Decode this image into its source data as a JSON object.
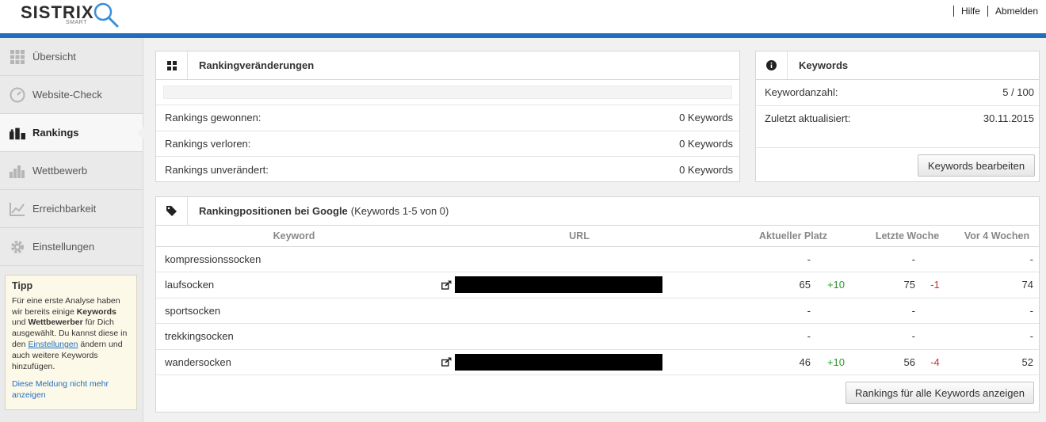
{
  "header": {
    "logo_text": "SISTRIX",
    "logo_sub": "SMART",
    "links": [
      "Hilfe",
      "Abmelden"
    ]
  },
  "colors": {
    "accent": "#1f6fbf",
    "positive": "#2a9a2a",
    "negative": "#d02f2f"
  },
  "sidebar": {
    "items": [
      {
        "label": "Übersicht",
        "icon": "grid-icon",
        "active": false
      },
      {
        "label": "Website-Check",
        "icon": "gauge-icon",
        "active": false
      },
      {
        "label": "Rankings",
        "icon": "rankings-icon",
        "active": true
      },
      {
        "label": "Wettbewerb",
        "icon": "bar-chart-icon",
        "active": false
      },
      {
        "label": "Erreichbarkeit",
        "icon": "line-chart-icon",
        "active": false
      },
      {
        "label": "Einstellungen",
        "icon": "gear-icon",
        "active": false
      }
    ],
    "tip": {
      "title": "Tipp",
      "text_1": "Für eine erste Analyse haben wir bereits einige ",
      "bold_1": "Keywords",
      "text_2": " und ",
      "bold_2": "Wettbewerber",
      "text_3": " für Dich ausgewählt. Du kannst diese in den ",
      "link": "Einstellungen",
      "text_4": " ändern und auch weitere Keywords hinzufügen.",
      "dismiss": "Diese Meldung nicht mehr anzeigen"
    }
  },
  "ranking_changes": {
    "title": "Rankingveränderungen",
    "rows": [
      {
        "label": "Rankings gewonnen:",
        "value": "0 Keywords"
      },
      {
        "label": "Rankings verloren:",
        "value": "0 Keywords"
      },
      {
        "label": "Rankings unverändert:",
        "value": "0 Keywords"
      }
    ]
  },
  "keywords_panel": {
    "title": "Keywords",
    "rows": [
      {
        "label": "Keywordanzahl:",
        "value": "5 / 100"
      },
      {
        "label": "Zuletzt aktualisiert:",
        "value": "30.11.2015"
      }
    ],
    "button": "Keywords bearbeiten"
  },
  "ranking_positions": {
    "title": "Rankingpositionen bei Google",
    "subtitle": "(Keywords 1-5 von 0)",
    "columns": [
      "Keyword",
      "URL",
      "Aktueller Platz",
      "Letzte Woche",
      "Vor 4 Wochen"
    ],
    "rows": [
      {
        "keyword": "kompressionssocken",
        "has_url": false,
        "current": "-",
        "current_change": "",
        "last_week": "-",
        "last_week_change": "",
        "four_weeks": "-"
      },
      {
        "keyword": "laufsocken",
        "has_url": true,
        "current": "65",
        "current_change": "+10",
        "last_week": "75",
        "last_week_change": "-1",
        "four_weeks": "74"
      },
      {
        "keyword": "sportsocken",
        "has_url": false,
        "current": "-",
        "current_change": "",
        "last_week": "-",
        "last_week_change": "",
        "four_weeks": "-"
      },
      {
        "keyword": "trekkingsocken",
        "has_url": false,
        "current": "-",
        "current_change": "",
        "last_week": "-",
        "last_week_change": "",
        "four_weeks": "-"
      },
      {
        "keyword": "wandersocken",
        "has_url": true,
        "current": "46",
        "current_change": "+10",
        "last_week": "56",
        "last_week_change": "-4",
        "four_weeks": "52"
      }
    ],
    "button": "Rankings für alle Keywords anzeigen"
  }
}
